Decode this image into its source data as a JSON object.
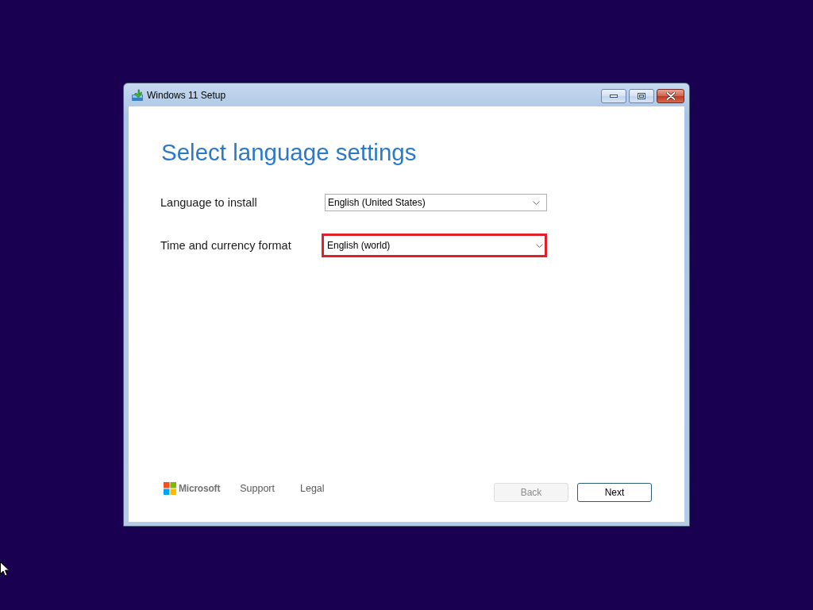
{
  "window": {
    "title": "Windows 11 Setup",
    "controls": [
      {
        "kind": "minimize"
      },
      {
        "kind": "maximize"
      },
      {
        "kind": "close"
      }
    ]
  },
  "heading": "Select language settings",
  "fields": [
    {
      "label": "Language to install",
      "value": "English (United States)",
      "highlighted": false
    },
    {
      "label": "Time and currency format",
      "value": "English (world)",
      "highlighted": true
    }
  ],
  "footer": {
    "brand": "Microsoft",
    "links": [
      "Support",
      "Legal"
    ]
  },
  "buttons": [
    {
      "label": "Back",
      "disabled": true
    },
    {
      "label": "Next",
      "disabled": false
    }
  ]
}
